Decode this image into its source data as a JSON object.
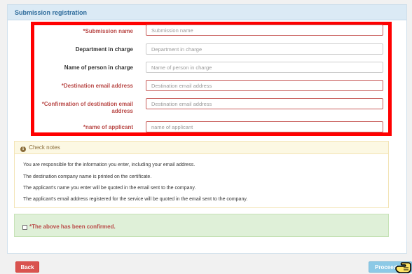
{
  "panel": {
    "heading": "Submission registration"
  },
  "form": {
    "fields": [
      {
        "label": "*Submission name",
        "placeholder": "Submission name",
        "required": true
      },
      {
        "label": "Department in charge",
        "placeholder": "Department in charge",
        "required": false
      },
      {
        "label": "Name of person in charge",
        "placeholder": "Name of person in charge",
        "required": false
      },
      {
        "label": "*Destination email address",
        "placeholder": "Destination email address",
        "required": true
      },
      {
        "label": "*Confirmation of destination email address",
        "placeholder": "Destination email address",
        "required": true
      },
      {
        "label": "*name of applicant",
        "placeholder": "name of applicant",
        "required": true
      }
    ]
  },
  "notes": {
    "heading": "Check notes",
    "icon": "info-circle-icon",
    "lines": [
      "You are responsible for the information you enter, including your email address.",
      "The destination company name is printed on the certificate.",
      "The applicant's name you enter will be quoted in the email sent to the company.",
      "The applicant's email address registered for the service will be quoted in the email sent to the company."
    ]
  },
  "confirm": {
    "label": "*The above has been confirmed."
  },
  "actions": {
    "back_label": "Back",
    "proceed_label": "Proceed"
  },
  "colors": {
    "required_text": "#b94a48",
    "highlight": "#ff0000",
    "back_button": "#d9534f",
    "proceed_button": "#8cc9e6",
    "confirm_bg": "#dff0d8",
    "notes_bg": "#fcf8e3"
  }
}
